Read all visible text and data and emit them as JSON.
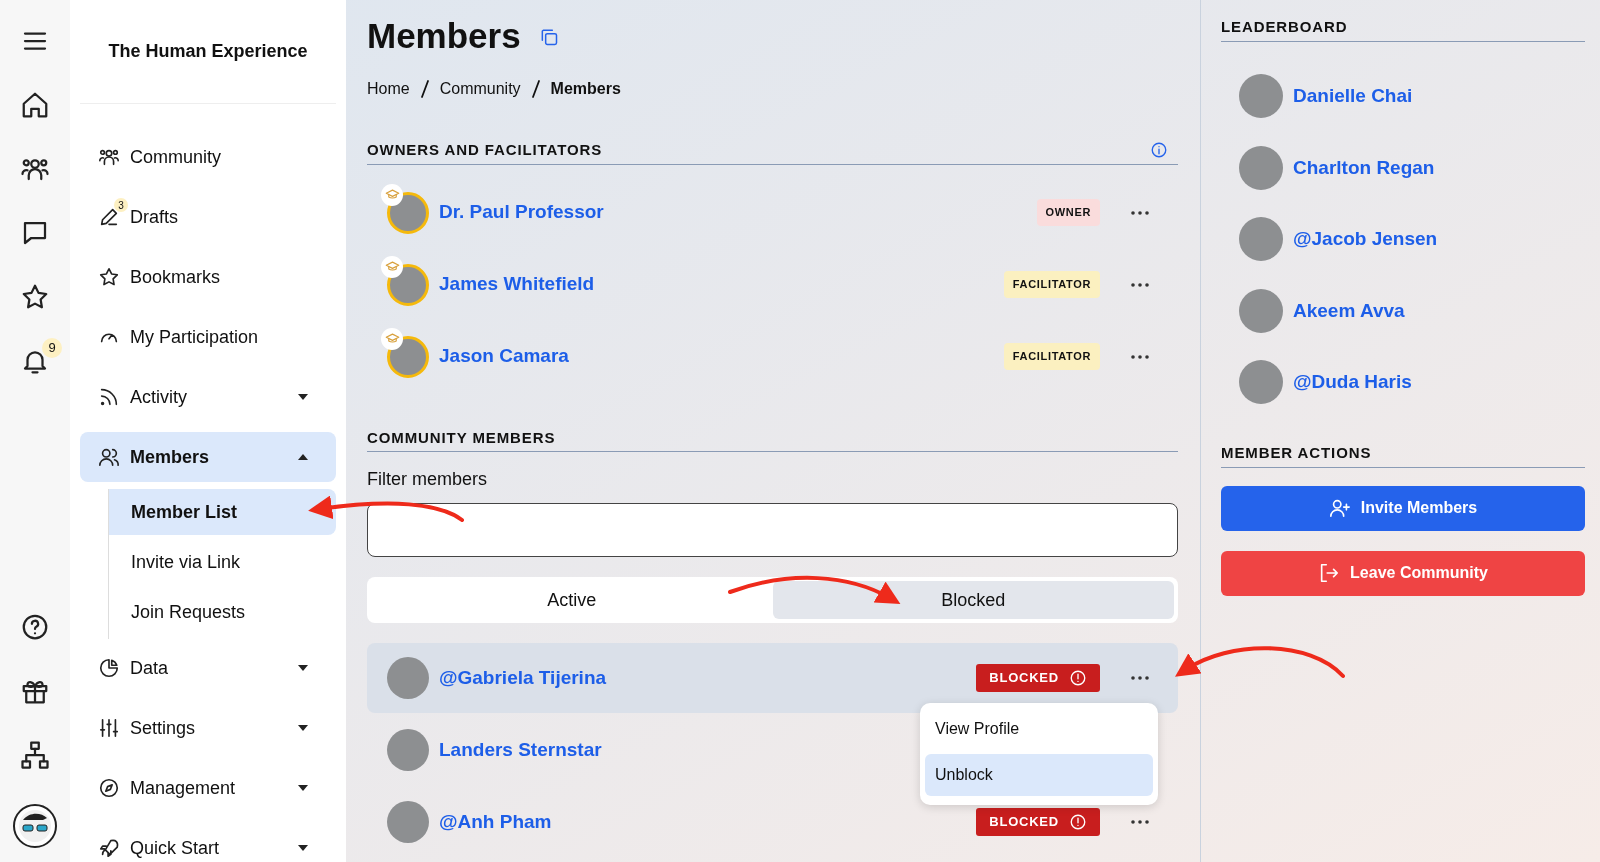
{
  "rail": {
    "notification_badge": "9"
  },
  "sidebar": {
    "title": "The Human Experience",
    "items": [
      {
        "label": "Community",
        "expandable": false,
        "selected": false
      },
      {
        "label": "Drafts",
        "badge": "3",
        "expandable": false,
        "selected": false
      },
      {
        "label": "Bookmarks",
        "expandable": false,
        "selected": false
      },
      {
        "label": "My Participation",
        "expandable": false,
        "selected": false
      },
      {
        "label": "Activity",
        "expandable": true,
        "expanded": false,
        "selected": false
      },
      {
        "label": "Members",
        "expandable": true,
        "expanded": true,
        "selected": true,
        "children": [
          {
            "label": "Member List",
            "selected": true
          },
          {
            "label": "Invite via Link",
            "selected": false
          },
          {
            "label": "Join Requests",
            "selected": false
          }
        ]
      },
      {
        "label": "Data",
        "expandable": true,
        "expanded": false,
        "selected": false
      },
      {
        "label": "Settings",
        "expandable": true,
        "expanded": false,
        "selected": false
      },
      {
        "label": "Management",
        "expandable": true,
        "expanded": false,
        "selected": false
      },
      {
        "label": "Quick Start",
        "expandable": true,
        "expanded": false,
        "selected": false
      }
    ]
  },
  "page": {
    "title": "Members",
    "breadcrumb": [
      "Home",
      "Community",
      "Members"
    ]
  },
  "owners": {
    "heading": "OWNERS AND FACILITATORS",
    "rows": [
      {
        "name": "Dr. Paul Professor",
        "badge": {
          "text": "OWNER",
          "kind": "owner"
        }
      },
      {
        "name": "James Whitefield",
        "badge": {
          "text": "FACILITATOR",
          "kind": "facilitator"
        }
      },
      {
        "name": "Jason Camara",
        "badge": {
          "text": "FACILITATOR",
          "kind": "facilitator"
        }
      }
    ]
  },
  "community": {
    "heading": "COMMUNITY MEMBERS",
    "filter_label": "Filter members",
    "tabs": [
      {
        "label": "Active",
        "selected": false
      },
      {
        "label": "Blocked",
        "selected": true
      }
    ],
    "rows": [
      {
        "name": "@Gabriela Tijerina",
        "badge": "BLOCKED",
        "more_button": true,
        "selected": true
      },
      {
        "name": "Landers Sternstar",
        "more_button": false,
        "selected": false
      },
      {
        "name": "@Anh Pham",
        "badge": "BLOCKED",
        "more_button": true,
        "selected": false
      }
    ],
    "menu": {
      "items": [
        {
          "label": "View Profile",
          "selected": false
        },
        {
          "label": "Unblock",
          "selected": true
        }
      ]
    }
  },
  "leaderboard": {
    "heading": "LEADERBOARD",
    "members": [
      "Danielle Chai",
      "Charlton Regan",
      "@Jacob Jensen",
      "Akeem Avva",
      "@Duda Haris"
    ]
  },
  "member_actions": {
    "heading": "MEMBER ACTIONS",
    "buttons": [
      {
        "label": "Invite Members",
        "kind": "invite"
      },
      {
        "label": "Leave Community",
        "kind": "leave"
      }
    ]
  }
}
